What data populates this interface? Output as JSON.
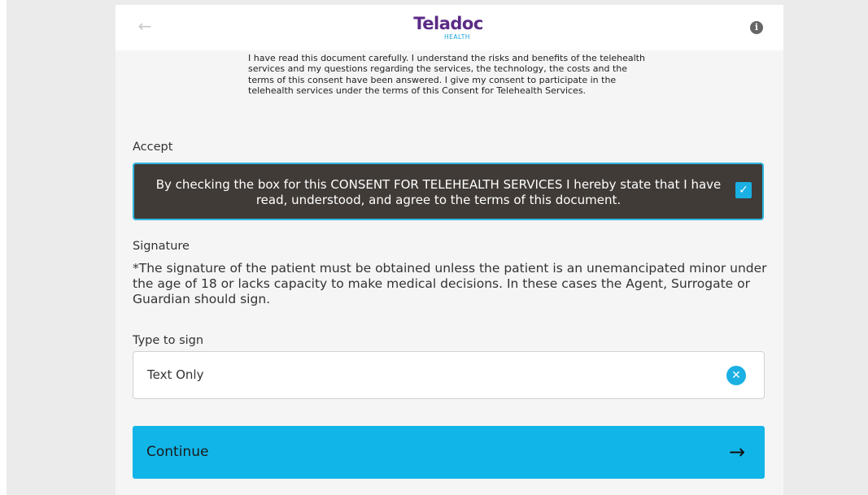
{
  "header": {
    "back_icon": "arrow-left-icon",
    "logo_main": "Teladoc",
    "logo_sub": "HEALTH",
    "info_icon": "info-icon",
    "info_glyph": "i"
  },
  "consent": {
    "text": "I have read this document carefully. I understand the risks and benefits of the telehealth services and my questions regarding the services, the technology, the costs and the terms of this consent have been answered. I give my consent to participate in the telehealth services under the terms of this Consent for Telehealth Services."
  },
  "accept": {
    "label": "Accept",
    "checkbox_text": "By checking the box for this CONSENT FOR TELEHEALTH SERVICES I hereby state that I have read, understood, and agree to the terms of this document.",
    "checked": true
  },
  "signature": {
    "label": "Signature",
    "note": "*The signature of the patient must be obtained unless the patient is an unemancipated minor under the age of 18 or lacks capacity to make medical decisions. In these cases the Agent, Surrogate or Guardian should sign."
  },
  "type_to_sign": {
    "label": "Type to sign",
    "value": "Text Only",
    "clear_icon": "clear-icon"
  },
  "continue_button": {
    "label": "Continue",
    "icon": "arrow-right-icon"
  },
  "colors": {
    "brand_purple": "#5b2b86",
    "accent_blue": "#12b5e8",
    "dark_box": "#403b37"
  }
}
